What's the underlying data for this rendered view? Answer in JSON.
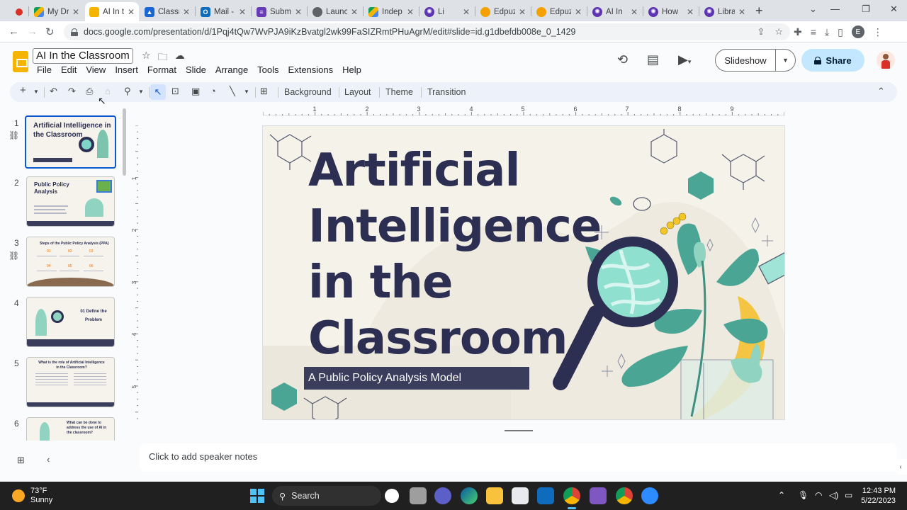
{
  "browser": {
    "tabs": [
      {
        "label": "",
        "favicon": "record-icon",
        "color": "#d93025"
      },
      {
        "label": "My Dr",
        "favicon": "drive-icon",
        "color": "#1a73e8"
      },
      {
        "label": "AI In t",
        "favicon": "slides-icon",
        "color": "#f4b400",
        "active": true
      },
      {
        "label": "Classr",
        "favicon": "classroom-icon",
        "color": "#1967d2"
      },
      {
        "label": "Mail -",
        "favicon": "outlook-icon",
        "color": "#0f6cbd"
      },
      {
        "label": "Subm",
        "favicon": "forms-icon",
        "color": "#673ab7"
      },
      {
        "label": "Launc",
        "favicon": "globe-icon",
        "color": "#5f6368"
      },
      {
        "label": "Indep",
        "favicon": "drive-icon",
        "color": "#1a73e8"
      },
      {
        "label": "Li",
        "favicon": "gear-icon",
        "color": "#5e35b1"
      },
      {
        "label": "Edpuz",
        "favicon": "edpuzzle-icon",
        "color": "#f4a100"
      },
      {
        "label": "Edpuz",
        "favicon": "edpuzzle-icon",
        "color": "#f4a100"
      },
      {
        "label": "AI In",
        "favicon": "gear-icon",
        "color": "#5e35b1"
      },
      {
        "label": "How",
        "favicon": "gear-icon",
        "color": "#5e35b1"
      },
      {
        "label": "Librar",
        "favicon": "gear-icon",
        "color": "#5e35b1"
      }
    ],
    "url": "docs.google.com/presentation/d/1Pqj4tQw7WvPJA9iKzBvatgl2wk99FaSIZRmtPHuAgrM/edit#slide=id.g1dbefdb008e_0_1429"
  },
  "app": {
    "title": "AI In the Classroom",
    "menu": [
      "File",
      "Edit",
      "View",
      "Insert",
      "Format",
      "Slide",
      "Arrange",
      "Tools",
      "Extensions",
      "Help"
    ],
    "slideshow_label": "Slideshow",
    "share_label": "Share"
  },
  "toolbar": {
    "background_label": "Background",
    "layout_label": "Layout",
    "theme_label": "Theme",
    "transition_label": "Transition"
  },
  "ruler": {
    "h_labels": [
      "1",
      "2",
      "3",
      "4",
      "5",
      "6",
      "7",
      "8",
      "9"
    ],
    "v_labels": [
      "1",
      "2",
      "3",
      "4",
      "5"
    ]
  },
  "filmstrip": {
    "slides": [
      {
        "num": "1",
        "title": "Artificial Intelligence in the Classroom",
        "active": true
      },
      {
        "num": "2",
        "title": "Public Policy Analysis"
      },
      {
        "num": "3",
        "title": "Steps of the Public Policy Analysis (PPA)"
      },
      {
        "num": "4",
        "title": "01 Define the Problem"
      },
      {
        "num": "5",
        "title": "What is the role of Artificial Intelligence in the Classroom?"
      },
      {
        "num": "6",
        "title": "What can be done to address the use of AI in the classroom?"
      }
    ]
  },
  "slide": {
    "title_lines": [
      "Artificial",
      "Intelligence",
      "in the",
      "Classroom"
    ],
    "subtitle": "A Public Policy Analysis Model"
  },
  "notes": {
    "placeholder": "Click to add speaker notes"
  },
  "taskbar": {
    "temperature": "73°F",
    "condition": "Sunny",
    "search_label": "Search",
    "time": "12:43 PM",
    "date": "5/22/2023"
  }
}
